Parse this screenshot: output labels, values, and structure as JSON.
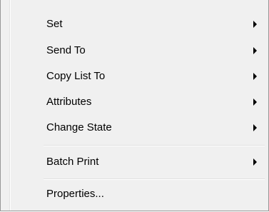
{
  "menu": {
    "items": [
      {
        "label": "Set",
        "has_submenu": true
      },
      {
        "label": "Send To",
        "has_submenu": true
      },
      {
        "label": "Copy List To",
        "has_submenu": true
      },
      {
        "label": "Attributes",
        "has_submenu": true
      },
      {
        "label": "Change State",
        "has_submenu": true
      },
      {
        "label": "Batch Print",
        "has_submenu": true
      },
      {
        "label": "Properties...",
        "has_submenu": false
      }
    ]
  }
}
